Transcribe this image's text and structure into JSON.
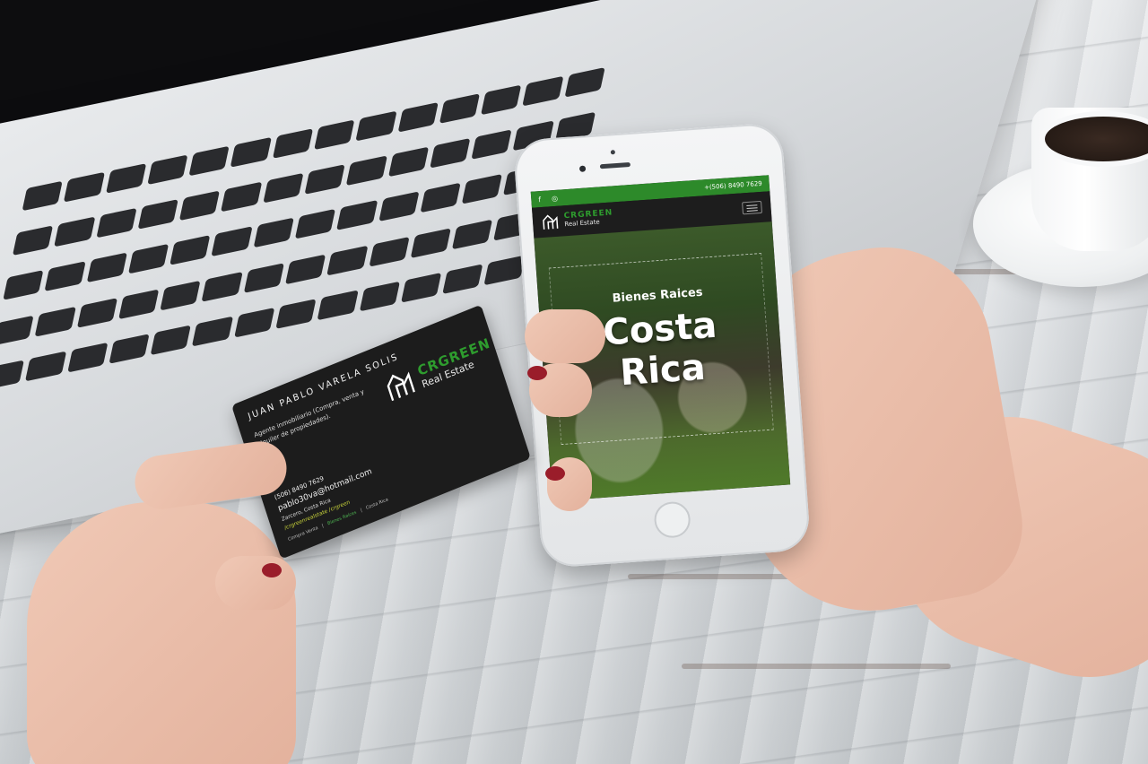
{
  "business_card": {
    "name": "JUAN PABLO VARELA SOLIS",
    "role": "Agente inmobiliario (Compra, venta y alquiler de propiedades).",
    "logo": {
      "brand": "CRGREEN",
      "sub": "Real Estate"
    },
    "phone": "(506) 8490 7629",
    "email": "pablo30va@hotmail.com",
    "address": "Zarcero, Costa Rica",
    "social": "/crgreenrealstate /crgreen",
    "footer": [
      "Compra Venta",
      "Bienes Raíces",
      "Costa Rica"
    ]
  },
  "phone_site": {
    "topbar": {
      "facebook_icon": "f",
      "instagram_icon": "◎",
      "phone": "+(506) 8490 7629"
    },
    "logo": {
      "brand": "CRGREEN",
      "sub": "Real Estate"
    },
    "hero": {
      "subtitle": "Bienes Raices",
      "title_line1": "Costa",
      "title_line2": "Rica"
    }
  },
  "colors": {
    "brand_green": "#2e9c2e",
    "card_bg": "#1c1c1c"
  }
}
